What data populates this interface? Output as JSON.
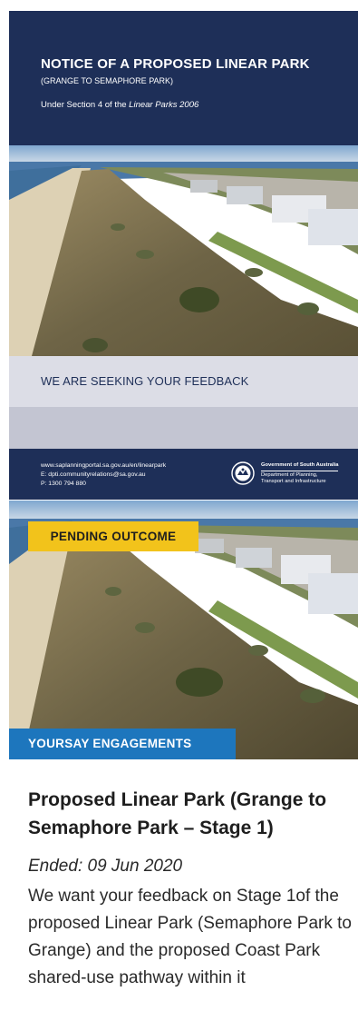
{
  "notice": {
    "title": "NOTICE OF A PROPOSED LINEAR PARK",
    "subtitle": "(GRANGE TO SEMAPHORE PARK)",
    "section_prefix": "Under Section 4 of the ",
    "section_act": "Linear Parks 2006",
    "feedback": "WE ARE SEEKING YOUR FEEDBACK",
    "contact_web": "www.saplanningportal.sa.gov.au/en/linearpark",
    "contact_email": "E: dpti.communityrelations@sa.gov.au",
    "contact_phone": "P: 1300 794 880",
    "gov_name": "Government of South Australia",
    "gov_dept_line1": "Department of Planning,",
    "gov_dept_line2": "Transport and Infrastructure",
    "header_color": "#1e2f58"
  },
  "card": {
    "status_badge": "PENDING OUTCOME",
    "category_badge": "YOURSAY ENGAGEMENTS",
    "title": "Proposed Linear Park (Grange to Semaphore Park – Stage 1)",
    "date": "Ended: 09 Jun 2020",
    "description": "We want your feedback on Stage 1of the proposed Linear Park (Semaphore Park to Grange) and the proposed Coast Park shared-use pathway within it",
    "status_color": "#f2c31b",
    "category_color": "#1d76bd"
  }
}
